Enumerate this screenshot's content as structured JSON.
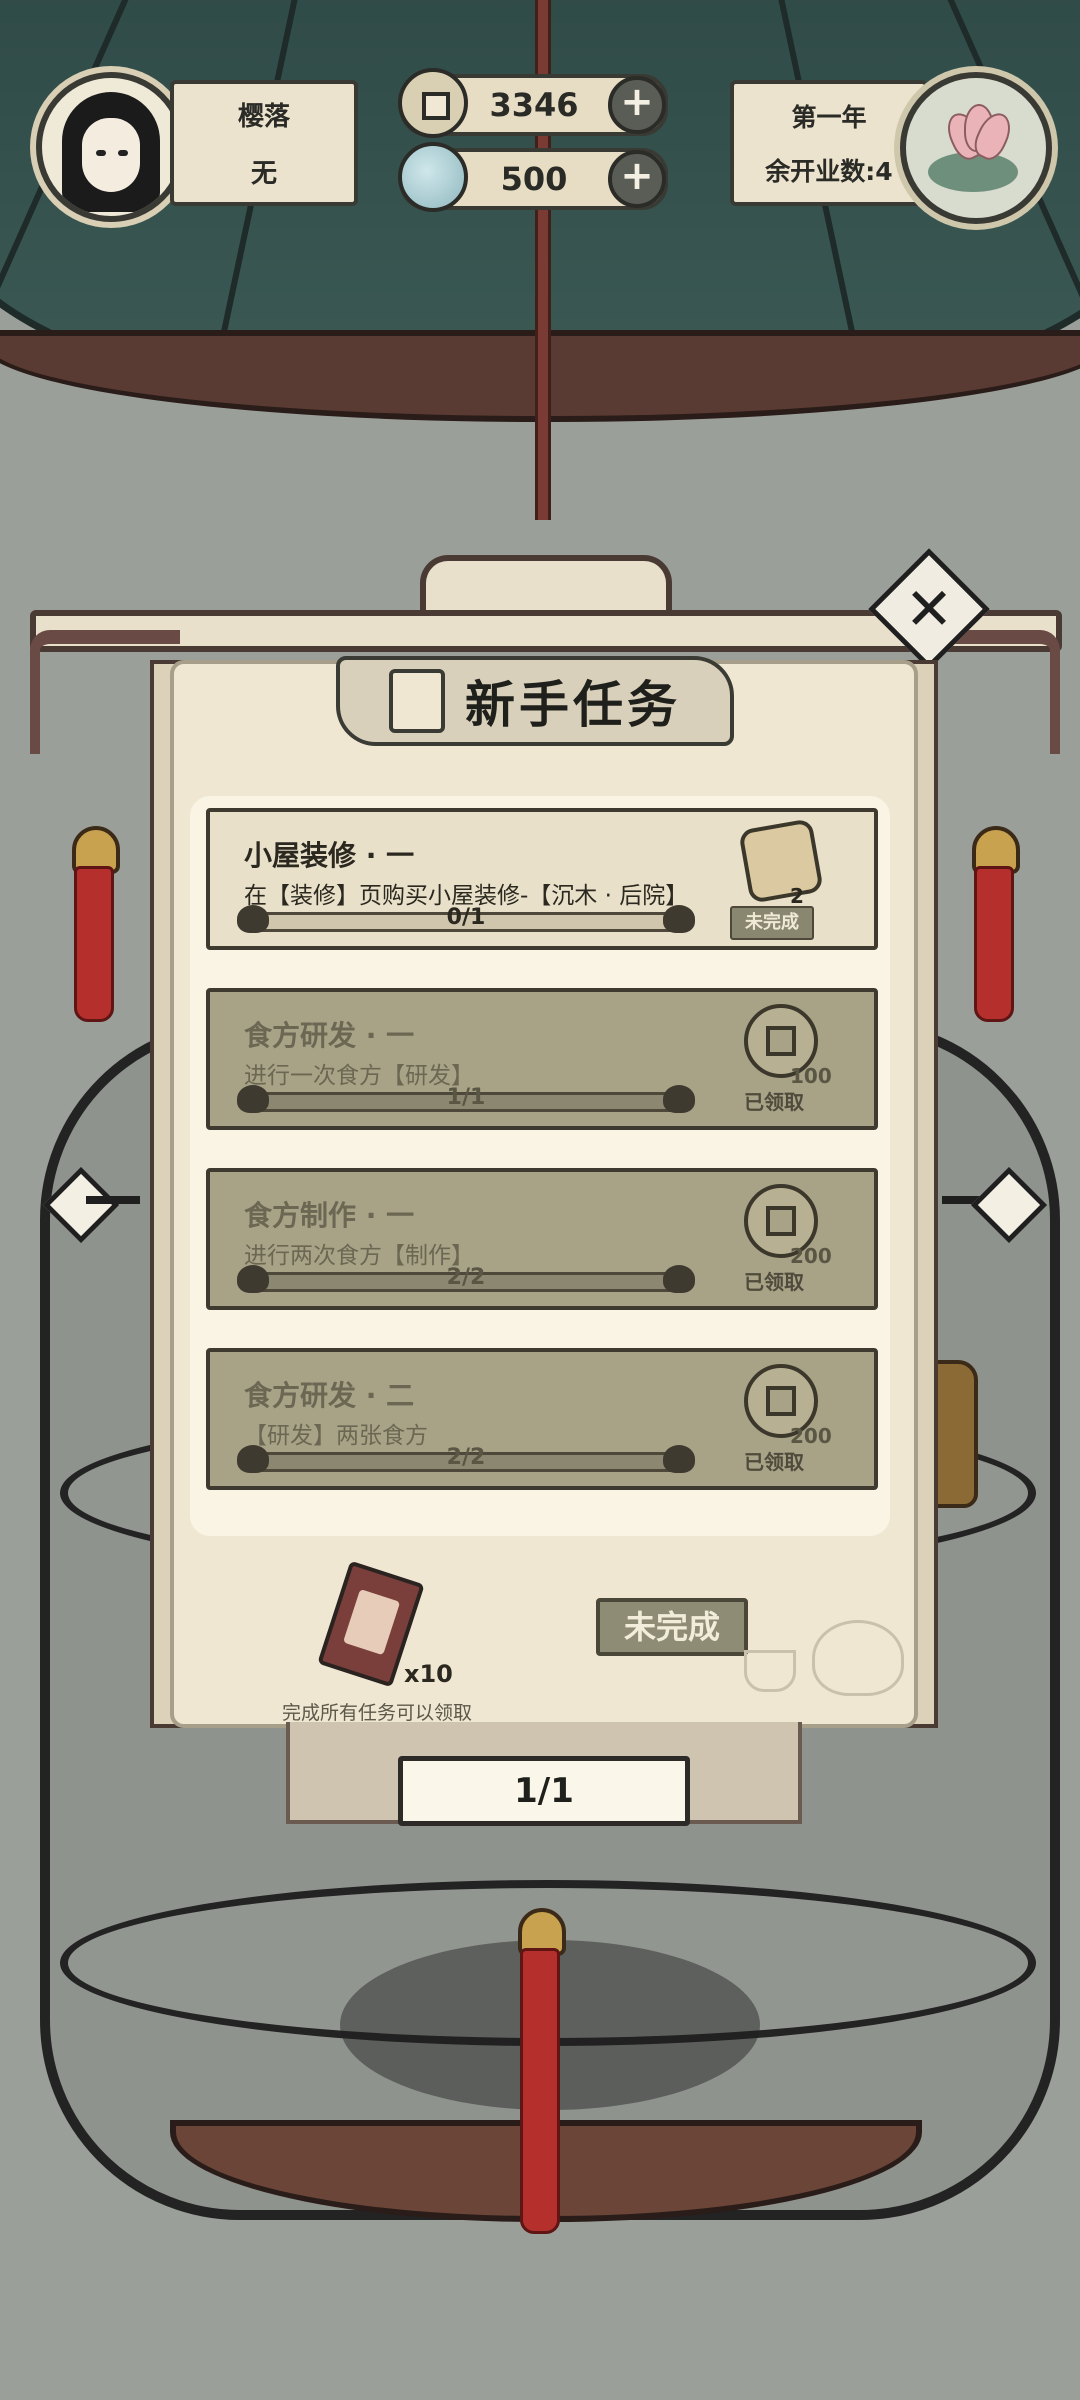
{
  "player": {
    "name": "樱落",
    "title": "无"
  },
  "currencies": [
    {
      "name": "coin",
      "value": "3346"
    },
    {
      "name": "jade",
      "value": "500"
    }
  ],
  "calendar": {
    "year": "第一年",
    "openings_left": "余开业数:4"
  },
  "modal": {
    "title": "新手任务",
    "tasks": [
      {
        "title": "小屋装修 · 一",
        "desc": "在【装修】页购买小屋装修-【沉木 · 后院】",
        "progress": "0/1",
        "progress_fraction": 0,
        "reward_icon": "scroll-icon",
        "reward_count": "2",
        "status": "未完成",
        "state": "active"
      },
      {
        "title": "食方研发 · 一",
        "desc": "进行一次食方【研发】",
        "progress": "1/1",
        "progress_fraction": 1,
        "reward_icon": "coin-icon",
        "reward_count": "100",
        "status": "已领取",
        "state": "done"
      },
      {
        "title": "食方制作 · 一",
        "desc": "进行两次食方【制作】",
        "progress": "2/2",
        "progress_fraction": 1,
        "reward_icon": "coin-icon",
        "reward_count": "200",
        "status": "已领取",
        "state": "done"
      },
      {
        "title": "食方研发 · 二",
        "desc": "【研发】两张食方",
        "progress": "2/2",
        "progress_fraction": 1,
        "reward_icon": "coin-icon",
        "reward_count": "200",
        "status": "已领取",
        "state": "done"
      }
    ],
    "final_reward": {
      "icon": "talisman-icon",
      "count": "x10",
      "caption": "完成所有任务可以领取",
      "button": "未完成"
    },
    "page_indicator": "1/1"
  },
  "colors": {
    "active_card": "#e8e0c9",
    "done_card": "#a8a387",
    "tassel": "#b5302d",
    "canopy": "#2f4a47"
  }
}
